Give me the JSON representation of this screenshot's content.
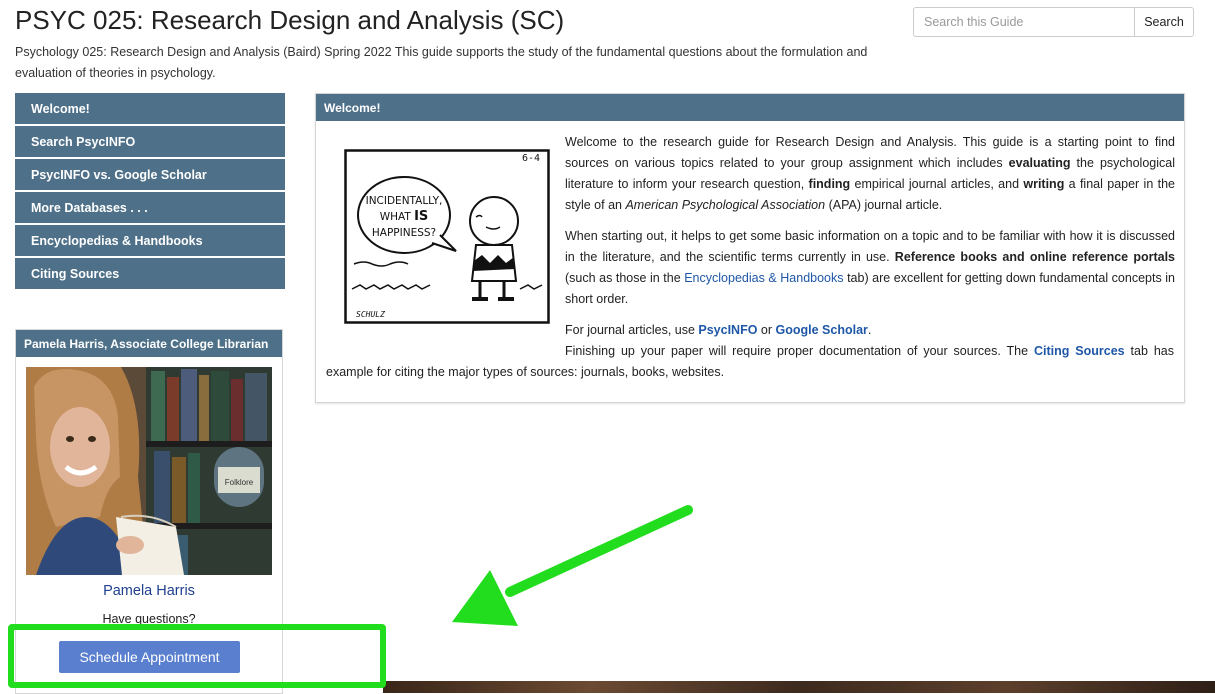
{
  "header": {
    "title": "PSYC 025: Research Design and Analysis (SC)",
    "description": "Psychology 025: Research Design and Analysis (Baird) Spring 2022 This guide supports the study of the fundamental questions about the formulation and evaluation of theories in psychology."
  },
  "search": {
    "placeholder": "Search this Guide",
    "value": "",
    "button_label": "Search"
  },
  "nav": {
    "items": [
      {
        "label": "Welcome!"
      },
      {
        "label": "Search PsycINFO"
      },
      {
        "label": "PsycINFO vs. Google Scholar"
      },
      {
        "label": "More Databases . . ."
      },
      {
        "label": "Encyclopedias & Handbooks"
      },
      {
        "label": "Citing Sources"
      }
    ]
  },
  "profile": {
    "heading": "Pamela Harris, Associate College Librarian",
    "name": "Pamela Harris",
    "question": "Have questions?",
    "button_label": "Schedule Appointment",
    "photo_book_label": "Folklore"
  },
  "welcome": {
    "heading": "Welcome!",
    "comic": {
      "date": "6-4",
      "line1": "INCIDENTALLY,",
      "line2a": "WHAT ",
      "line2b": "IS",
      "line3": "HAPPINESS?",
      "signature": "SCHULZ"
    },
    "p1": {
      "t1": "Welcome to the research guide for Research Design and Analysis. This guide is a starting point to find sources on various topics related to your group assignment which includes ",
      "b1": "evaluating",
      "t2": " the psychological literature to inform your research question, ",
      "b2": "finding",
      "t3": " empirical journal articles, and ",
      "b3": "writing",
      "t4": " a final paper in the style of an ",
      "i1": "American Psychological Association",
      "t5": " (APA) journal article."
    },
    "p2": {
      "t1": "When starting out, it helps to get some basic information on a topic and to be familiar with how it is discussed in the literature, and the scientific terms currently in use. ",
      "b1": "Reference books and online reference portals",
      "t2": " (such as those in the ",
      "link": "Encyclopedias & Handbooks",
      "t3": " tab) are excellent for getting down fundamental concepts in short order."
    },
    "p3": {
      "t1": "For journal articles, use ",
      "link1": "PsycINFO",
      "t2": " or ",
      "link2": "Google Scholar",
      "t3": "."
    },
    "p4": {
      "t1": "Finishing up your paper will require proper documentation of your sources. The ",
      "link": "Citing Sources",
      "t2": " tab has example for citing the major types of sources: journals, books, websites."
    }
  },
  "colors": {
    "nav_bg": "#4f7089",
    "link": "#1f57a8",
    "button": "#5a7fcf",
    "highlight": "#22dd1e"
  }
}
